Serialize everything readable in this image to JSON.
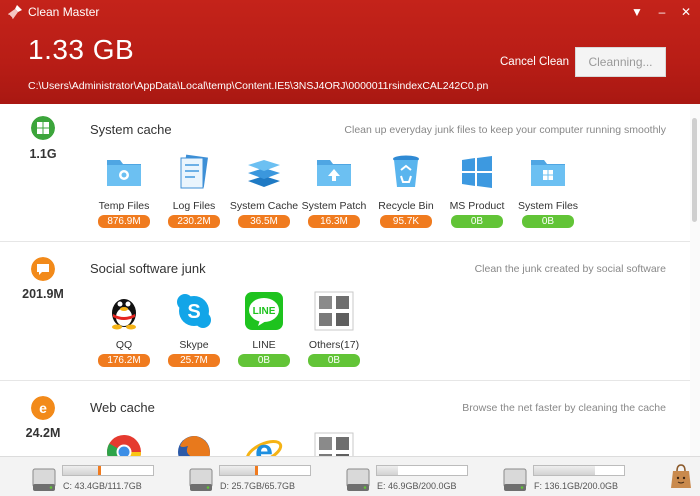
{
  "app": {
    "title": "Clean Master"
  },
  "window": {
    "menu_glyph": "▼",
    "minimize_glyph": "–",
    "close_glyph": "✕"
  },
  "summary": {
    "total_size": "1.33 GB",
    "current_path": "C:\\Users\\Administrator\\AppData\\Local\\temp\\Content.IE5\\3NSJ4ORJ\\0000011rsindexCAL242C0.pn",
    "cancel_label": "Cancel Clean",
    "clean_button_label": "Cleanning..."
  },
  "sections": [
    {
      "title": "System cache",
      "size": "1.1G",
      "description": "Clean up everyday junk files to keep your computer running smoothly",
      "icon": "windows-icon",
      "items": [
        {
          "label": "Temp Files",
          "value": "876.9M",
          "status": "orange",
          "icon": "temp-files-folder-icon"
        },
        {
          "label": "Log Files",
          "value": "230.2M",
          "status": "orange",
          "icon": "log-files-icon"
        },
        {
          "label": "System Cache",
          "value": "36.5M",
          "status": "orange",
          "icon": "system-cache-stack-icon"
        },
        {
          "label": "System Patch",
          "value": "16.3M",
          "status": "orange",
          "icon": "system-patch-folder-icon"
        },
        {
          "label": "Recycle Bin",
          "value": "95.7K",
          "status": "orange",
          "icon": "recycle-bin-icon"
        },
        {
          "label": "MS Product",
          "value": "0B",
          "status": "green",
          "icon": "ms-product-icon"
        },
        {
          "label": "System Files",
          "value": "0B",
          "status": "green",
          "icon": "system-files-folder-icon"
        }
      ]
    },
    {
      "title": "Social software junk",
      "size": "201.9M",
      "description": "Clean the junk created by social software",
      "icon": "chat-bubble-icon",
      "items": [
        {
          "label": "QQ",
          "value": "176.2M",
          "status": "orange",
          "icon": "qq-penguin-icon"
        },
        {
          "label": "Skype",
          "value": "25.7M",
          "status": "orange",
          "icon": "skype-icon"
        },
        {
          "label": "LINE",
          "value": "0B",
          "status": "green",
          "icon": "line-icon",
          "icon_text": "LINE"
        },
        {
          "label": "Others(17)",
          "value": "0B",
          "status": "green",
          "icon": "others-grid-icon"
        }
      ]
    },
    {
      "title": "Web cache",
      "size": "24.2M",
      "description": "Browse the net faster by cleaning the cache",
      "icon": "internet-explorer-icon",
      "items": [
        {
          "label": "",
          "value": "",
          "icon": "chrome-icon"
        },
        {
          "label": "",
          "value": "",
          "icon": "firefox-icon"
        },
        {
          "label": "",
          "value": "",
          "icon": "ie-browser-icon"
        },
        {
          "label": "",
          "value": "",
          "icon": "others-grid-icon"
        }
      ]
    }
  ],
  "drives": [
    {
      "label": "C: 43.4GB/111.7GB",
      "used_fraction": 0.39
    },
    {
      "label": "D: 25.7GB/65.7GB",
      "used_fraction": 0.39
    },
    {
      "label": "E: 46.9GB/200.0GB",
      "used_fraction": 0.23
    },
    {
      "label": "F: 136.1GB/200.0GB",
      "used_fraction": 0.68
    }
  ],
  "colors": {
    "header_red": "#b81d16",
    "badge_orange": "#f07b1f",
    "badge_green": "#62c437",
    "section_icon_green": "#3ca53b",
    "section_icon_orange": "#f28a1a"
  }
}
